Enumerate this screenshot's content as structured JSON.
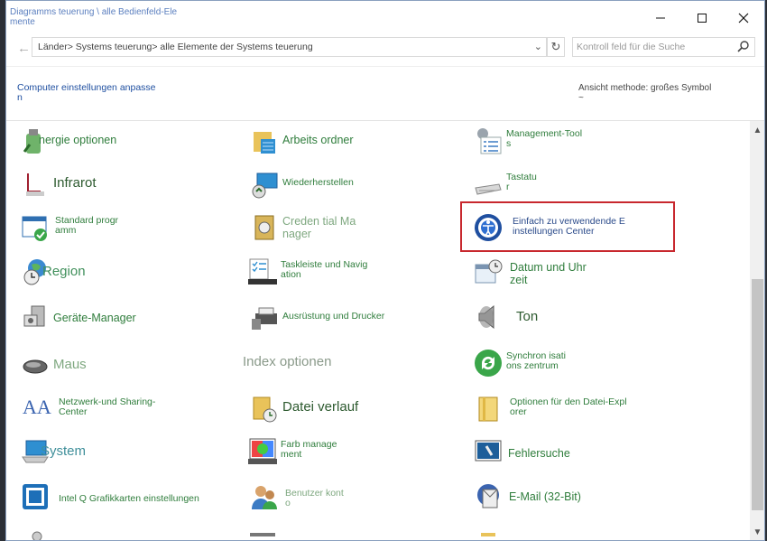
{
  "window": {
    "title": "Diagramms teuerung \\ alle Bedienfeld-Ele\nmente",
    "minimize_icon": "minimize-icon",
    "maximize_icon": "maximize-icon",
    "close_icon": "close-icon"
  },
  "address": {
    "breadcrumb": "Länder> Systems teuerung> alle Elemente der Systems teuerung",
    "search_placeholder": "Kontroll feld für die Suche"
  },
  "header": {
    "settings_link": "Computer einstellungen anpasse\nn",
    "view_mode": "Ansicht methode: großes Symbol\n~"
  },
  "items": [
    {
      "label": "nergie optionen",
      "icon": "power-options-icon"
    },
    {
      "label": "Arbeits ordner",
      "icon": "work-folders-icon"
    },
    {
      "label": "Management-Tool\ns",
      "icon": "admin-tools-icon"
    },
    {
      "label": "Infrarot",
      "icon": "infrared-icon"
    },
    {
      "label": "Wiederherstellen",
      "icon": "recovery-icon"
    },
    {
      "label": "Tastatu\nr",
      "icon": "keyboard-icon"
    },
    {
      "label": "Standard progr\namm",
      "icon": "default-programs-icon"
    },
    {
      "label": "Creden tial Ma\nnager",
      "icon": "credential-manager-icon"
    },
    {
      "label": "Einfach zu verwendende E\ninstellungen Center",
      "icon": "ease-of-access-icon"
    },
    {
      "label": "Region",
      "icon": "region-icon"
    },
    {
      "label": "Taskleiste und Navig\nation",
      "icon": "taskbar-icon"
    },
    {
      "label": "Datum und Uhr\nzeit",
      "icon": "date-time-icon"
    },
    {
      "label": "Geräte-Manager",
      "icon": "device-manager-icon"
    },
    {
      "label": "Ausrüstung und Drucker",
      "icon": "devices-printers-icon"
    },
    {
      "label": "Ton",
      "icon": "sound-icon"
    },
    {
      "label": "Maus",
      "icon": "mouse-icon"
    },
    {
      "label": "Index optionen",
      "icon": "indexing-options-icon"
    },
    {
      "label": "Synchron isati\nons zentrum",
      "icon": "sync-center-icon"
    },
    {
      "label": "Netzwerk-und Sharing-\nCenter",
      "icon": "network-sharing-icon"
    },
    {
      "label": "Datei verlauf",
      "icon": "file-history-icon"
    },
    {
      "label": "Optionen für den Datei-Expl\norer",
      "icon": "file-explorer-options-icon"
    },
    {
      "label": "System",
      "icon": "system-icon"
    },
    {
      "label": "Farb manage\nment",
      "icon": "color-management-icon"
    },
    {
      "label": "Fehlersuche",
      "icon": "troubleshooting-icon"
    },
    {
      "label": "Intel Q Grafikkarten einstellungen",
      "icon": "intel-graphics-icon"
    },
    {
      "label": "Benutzer kont\no",
      "icon": "user-accounts-icon"
    },
    {
      "label": "E-Mail (32-Bit)",
      "icon": "mail-icon"
    }
  ],
  "colors": {
    "label_green": "#2f7d3c",
    "link_blue": "#1f4fa0",
    "selection_red": "#c8282e"
  }
}
